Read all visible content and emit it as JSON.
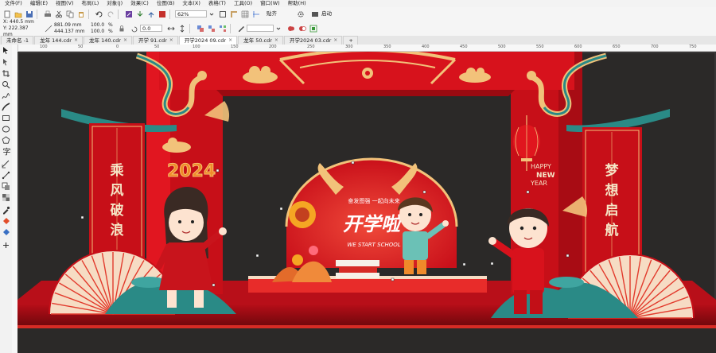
{
  "menu": [
    "文件(F)",
    "编辑(E)",
    "视图(V)",
    "布局(L)",
    "对象(J)",
    "效果(C)",
    "位图(B)",
    "文本(X)",
    "表格(T)",
    "工具(O)",
    "窗口(W)",
    "帮助(H)"
  ],
  "toolbar": {
    "zoom": "62%",
    "snap_label": "贴齐",
    "launch_label": "启动"
  },
  "property_bar": {
    "x": "X: 440.5 mm",
    "y": "Y: 222.387 mm",
    "width": "881.09 mm",
    "height": "444.137 mm",
    "scale_x": "100.0",
    "scale_y": "100.0",
    "pct": "%",
    "rotation": "0.0"
  },
  "tabs": [
    {
      "label": "未命名 -1",
      "active": false
    },
    {
      "label": "龙年 144.cdr",
      "active": false
    },
    {
      "label": "龙年 140.cdr",
      "active": false
    },
    {
      "label": "开学 91.cdr",
      "active": false
    },
    {
      "label": "开学2024 09.cdr",
      "active": true
    },
    {
      "label": "龙年 50.cdr",
      "active": false
    },
    {
      "label": "开学2024 03.cdr",
      "active": false
    }
  ],
  "ruler_labels": [
    "100",
    "50",
    "0",
    "50",
    "100",
    "150",
    "200",
    "250",
    "300",
    "350",
    "400",
    "450",
    "500",
    "550",
    "600",
    "650",
    "700",
    "750",
    "800"
  ],
  "artwork": {
    "year": "2024",
    "title": "开学啦",
    "subtitle": "WE START SCHOOL",
    "arc_slogan": "奋发图强 一起向未来",
    "left_scroll": [
      "乘",
      "风",
      "破",
      "浪"
    ],
    "right_scroll": [
      "梦",
      "想",
      "启",
      "航"
    ],
    "happy_new_year": [
      "HAPPY",
      "NEW",
      "YEAR"
    ]
  },
  "colors": {
    "accent_red": "#d8121c",
    "dark_red": "#9c0a12",
    "gold": "#f2c27a",
    "teal": "#2a8a86",
    "canvas_bg": "#2b2928"
  }
}
